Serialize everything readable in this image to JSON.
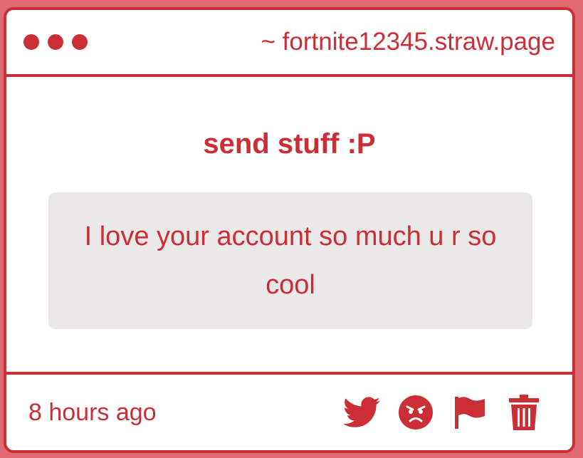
{
  "titlebar": {
    "url": "~ fortnite12345.straw.page"
  },
  "main": {
    "prompt": "send stuff :P",
    "message": "I love your account so much u r so cool"
  },
  "footer": {
    "time": "8 hours ago",
    "actions": [
      "twitter-icon",
      "angry-face-icon",
      "flag-icon",
      "trash-icon"
    ]
  },
  "colors": {
    "accent": "#cc2e36",
    "background": "#df6a72",
    "message_bg": "#ebe8e9"
  }
}
